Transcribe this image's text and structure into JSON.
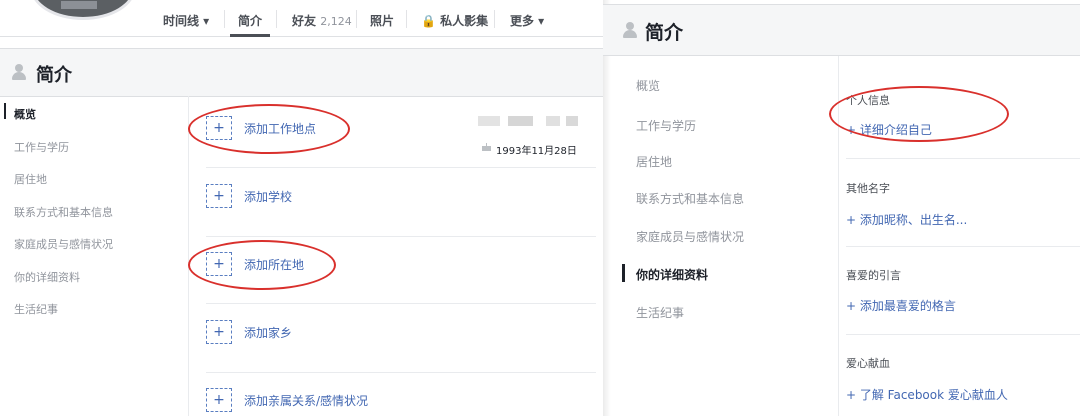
{
  "left": {
    "nav": [
      {
        "label": "时间线 ▾",
        "count": ""
      },
      {
        "label": "简介",
        "count": ""
      },
      {
        "label": "好友",
        "count": "2,124"
      },
      {
        "label": "照片",
        "count": ""
      },
      {
        "label": "🔒 私人影集",
        "count": ""
      },
      {
        "label": "更多 ▾",
        "count": ""
      }
    ],
    "about_title": "简介",
    "menu": [
      "概览",
      "工作与学历",
      "居住地",
      "联系方式和基本信息",
      "家庭成员与感情状况",
      "你的详细资料",
      "生活纪事"
    ],
    "add_items": [
      "添加工作地点",
      "添加学校",
      "添加所在地",
      "添加家乡",
      "添加亲属关系/感情状况"
    ],
    "plus": "+",
    "birthday": "1993年11月28日"
  },
  "right": {
    "about_title": "简介",
    "menu": [
      "概览",
      "工作与学历",
      "居住地",
      "联系方式和基本信息",
      "家庭成员与感情状况",
      "你的详细资料",
      "生活纪事"
    ],
    "sections": [
      {
        "title": "个人信息",
        "link": "+ 详细介绍自己"
      },
      {
        "title": "其他名字",
        "link": "+ 添加昵称、出生名..."
      },
      {
        "title": "喜爱的引言",
        "link": "+ 添加最喜爱的格言"
      },
      {
        "title": "爱心献血",
        "link": "+ 了解 Facebook 爱心献血人"
      }
    ]
  },
  "colors": {
    "link": "#4267b2",
    "highlight_circle": "#d9302c",
    "muted_text": "#90949c"
  }
}
